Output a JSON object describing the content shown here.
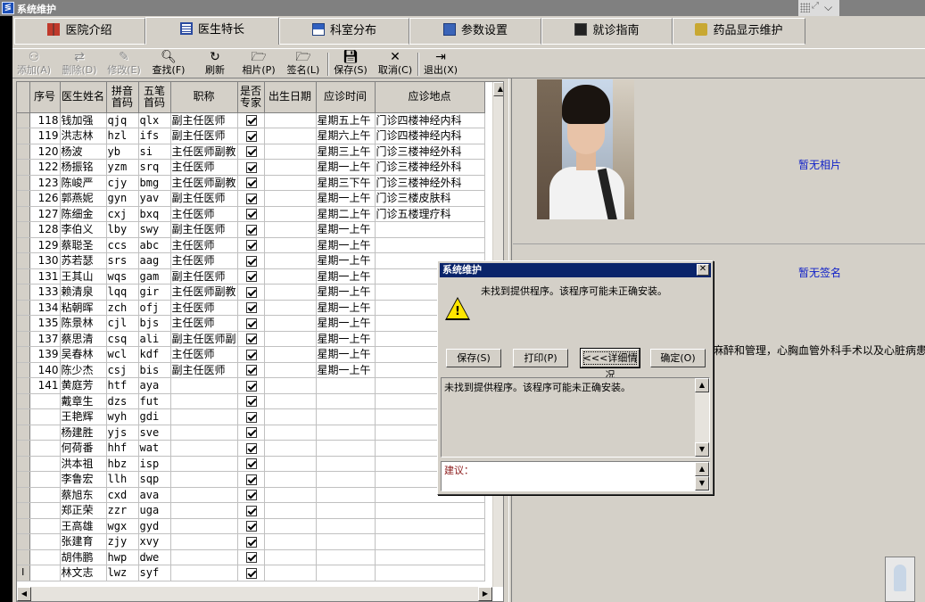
{
  "window": {
    "title": "系统维护"
  },
  "tabs": [
    {
      "label": "医院介绍",
      "icon": "book-icon"
    },
    {
      "label": "医生特长",
      "icon": "list-icon",
      "active": true
    },
    {
      "label": "科室分布",
      "icon": "department-icon"
    },
    {
      "label": "参数设置",
      "icon": "settings-icon"
    },
    {
      "label": "就诊指南",
      "icon": "guide-icon"
    },
    {
      "label": "药品显示维护",
      "icon": "drug-icon"
    }
  ],
  "toolbar": {
    "add": "添加(A)",
    "delete": "删除(D)",
    "edit": "修改(E)",
    "find": "查找(F)",
    "refresh": "刷新",
    "photo": "相片(P)",
    "sign": "签名(L)",
    "save": "保存(S)",
    "cancel": "取消(C)",
    "exit": "退出(X)"
  },
  "grid": {
    "columns": [
      "序号",
      "医生姓名",
      "拼音首码",
      "五笔首码",
      "职称",
      "是否专家",
      "出生日期",
      "应诊时间",
      "应诊地点"
    ],
    "rows": [
      [
        "118",
        "钱加强",
        "qjq",
        "qlx",
        "副主任医师",
        true,
        "",
        "星期五上午",
        "门诊四楼神经内科"
      ],
      [
        "119",
        "洪志林",
        "hzl",
        "ifs",
        "副主任医师",
        true,
        "",
        "星期六上午",
        "门诊四楼神经内科"
      ],
      [
        "120",
        "杨波",
        "yb",
        "si",
        "主任医师副教",
        true,
        "",
        "星期三上午",
        "门诊三楼神经外科"
      ],
      [
        "122",
        "杨振铭",
        "yzm",
        "srq",
        "主任医师",
        true,
        "",
        "星期一上午",
        "门诊三楼神经外科"
      ],
      [
        "123",
        "陈峻严",
        "cjy",
        "bmg",
        "主任医师副教",
        true,
        "",
        "星期三下午",
        "门诊三楼神经外科"
      ],
      [
        "126",
        "郭燕妮",
        "gyn",
        "yav",
        "副主任医师",
        true,
        "",
        "星期一上午",
        "门诊三楼皮肤科"
      ],
      [
        "127",
        "陈细金",
        "cxj",
        "bxq",
        "主任医师",
        true,
        "",
        "星期二上午",
        "门诊五楼理疗科"
      ],
      [
        "128",
        "李伯义",
        "lby",
        "swy",
        "副主任医师",
        true,
        "",
        "星期一上午",
        ""
      ],
      [
        "129",
        "蔡聪圣",
        "ccs",
        "abc",
        "主任医师",
        true,
        "",
        "星期一上午",
        ""
      ],
      [
        "130",
        "苏若瑟",
        "srs",
        "aag",
        "主任医师",
        true,
        "",
        "星期一上午",
        ""
      ],
      [
        "131",
        "王其山",
        "wqs",
        "gam",
        "副主任医师",
        true,
        "",
        "星期一上午",
        ""
      ],
      [
        "133",
        "赖清泉",
        "lqq",
        "gir",
        "主任医师副教",
        true,
        "",
        "星期一上午",
        ""
      ],
      [
        "134",
        "粘朝晖",
        "zch",
        "ofj",
        "主任医师",
        true,
        "",
        "星期一上午",
        ""
      ],
      [
        "135",
        "陈景林",
        "cjl",
        "bjs",
        "主任医师",
        true,
        "",
        "星期一上午",
        ""
      ],
      [
        "137",
        "蔡思清",
        "csq",
        "ali",
        "副主任医师副",
        true,
        "",
        "星期一上午",
        ""
      ],
      [
        "139",
        "吴春林",
        "wcl",
        "kdf",
        "主任医师",
        true,
        "",
        "星期一上午",
        ""
      ],
      [
        "140",
        "陈少杰",
        "csj",
        "bis",
        "副主任医师",
        true,
        "",
        "星期一上午",
        ""
      ],
      [
        "141",
        "黄庭芳",
        "htf",
        "aya",
        "",
        true,
        "",
        "",
        ""
      ],
      [
        "",
        "戴章生",
        "dzs",
        "fut",
        "",
        true,
        "",
        "",
        ""
      ],
      [
        "",
        "王艳辉",
        "wyh",
        "gdi",
        "",
        true,
        "",
        "",
        ""
      ],
      [
        "",
        "杨建胜",
        "yjs",
        "sve",
        "",
        true,
        "",
        "",
        ""
      ],
      [
        "",
        "何荷番",
        "hhf",
        "wat",
        "",
        true,
        "",
        "",
        ""
      ],
      [
        "",
        "洪本祖",
        "hbz",
        "isp",
        "",
        true,
        "",
        "",
        ""
      ],
      [
        "",
        "李鲁宏",
        "llh",
        "sqp",
        "",
        true,
        "",
        "",
        ""
      ],
      [
        "",
        "蔡旭东",
        "cxd",
        "ava",
        "",
        true,
        "",
        "",
        ""
      ],
      [
        "",
        "郑正荣",
        "zzr",
        "uga",
        "",
        true,
        "",
        "",
        ""
      ],
      [
        "",
        "王高雄",
        "wgx",
        "gyd",
        "",
        true,
        "",
        "",
        ""
      ],
      [
        "",
        "张建育",
        "zjy",
        "xvy",
        "",
        true,
        "",
        "",
        ""
      ],
      [
        "",
        "胡伟鹏",
        "hwp",
        "dwe",
        "",
        true,
        "",
        "",
        ""
      ],
      [
        "",
        "林文志",
        "lwz",
        "syf",
        "",
        true,
        "",
        "",
        ""
      ]
    ],
    "current_row_marker": "I"
  },
  "right_panel": {
    "no_photo": "暂无相片",
    "no_signature": "暂无签名",
    "description": "麻醉和管理，心胸血管外科手术以及心脏病患者非"
  },
  "dialog": {
    "title": "系统维护",
    "message": "未找到提供程序。该程序可能未正确安装。",
    "buttons": {
      "save": "保存(S)",
      "print": "打印(P)",
      "details": "<<<详细情况",
      "ok": "确定(O)"
    },
    "detail_text": "未找到提供程序。该程序可能未正确安装。",
    "suggestion_label": "建议："
  }
}
